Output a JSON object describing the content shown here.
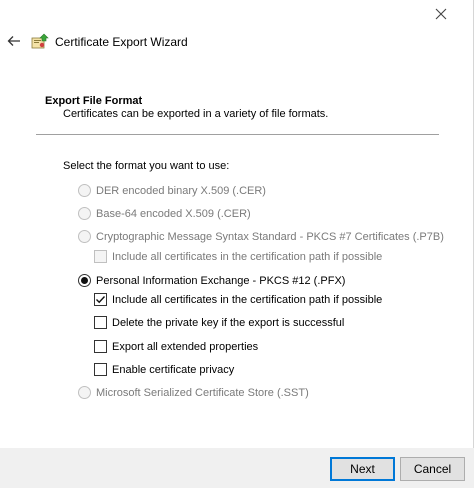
{
  "window": {
    "title": "Certificate Export Wizard"
  },
  "page": {
    "heading": "Export File Format",
    "subheading": "Certificates can be exported in a variety of file formats.",
    "prompt": "Select the format you want to use:"
  },
  "options": {
    "der": {
      "label": "DER encoded binary X.509 (.CER)",
      "enabled": false,
      "selected": false
    },
    "base64": {
      "label": "Base-64 encoded X.509 (.CER)",
      "enabled": false,
      "selected": false
    },
    "pkcs7": {
      "label": "Cryptographic Message Syntax Standard - PKCS #7 Certificates (.P7B)",
      "enabled": false,
      "selected": false
    },
    "pkcs7_include_all": {
      "label": "Include all certificates in the certification path if possible",
      "enabled": false,
      "checked": false
    },
    "pfx": {
      "label": "Personal Information Exchange - PKCS #12 (.PFX)",
      "enabled": true,
      "selected": true
    },
    "pfx_include_all": {
      "label": "Include all certificates in the certification path if possible",
      "enabled": true,
      "checked": true
    },
    "pfx_delete_key": {
      "label": "Delete the private key if the export is successful",
      "enabled": true,
      "checked": false
    },
    "pfx_export_ext": {
      "label": "Export all extended properties",
      "enabled": true,
      "checked": false
    },
    "pfx_privacy": {
      "label": "Enable certificate privacy",
      "enabled": true,
      "checked": false
    },
    "sst": {
      "label": "Microsoft Serialized Certificate Store (.SST)",
      "enabled": false,
      "selected": false
    }
  },
  "buttons": {
    "next": "Next",
    "cancel": "Cancel"
  },
  "icons": {
    "close": "close-icon",
    "back": "back-arrow-icon",
    "app": "certificate-wizard-icon"
  },
  "colors": {
    "accent": "#0078d7",
    "footer": "#f0f0f0",
    "disabled_text": "#7a7a7a"
  }
}
